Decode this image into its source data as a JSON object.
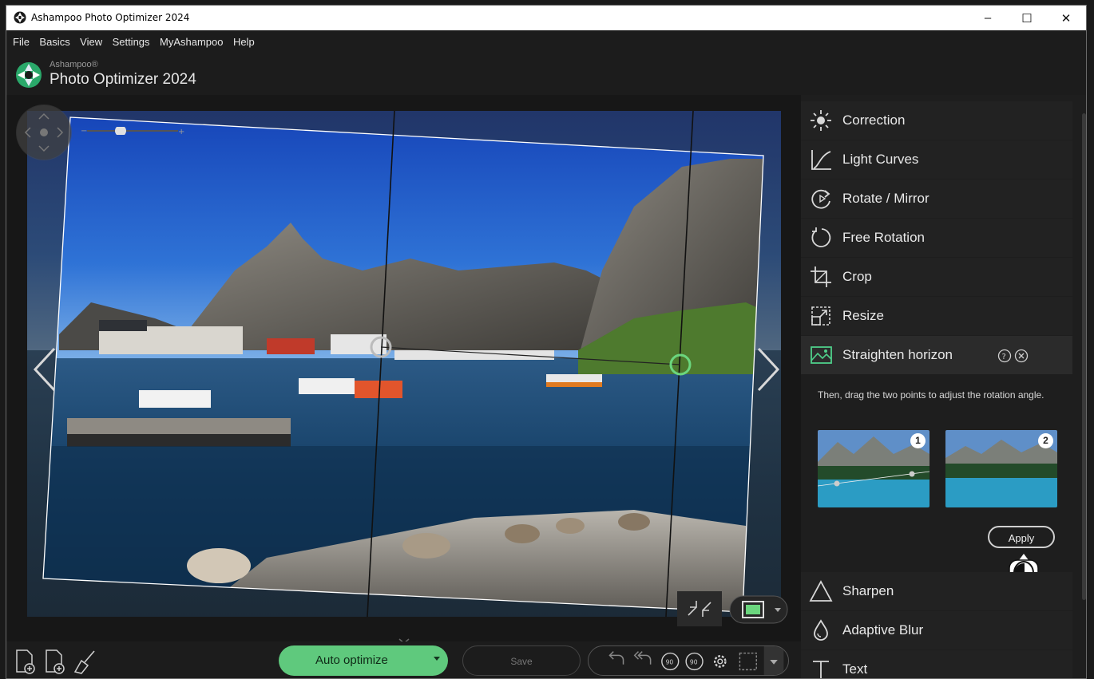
{
  "window": {
    "title": "Ashampoo Photo Optimizer 2024",
    "controls": {
      "minimize": "–",
      "maximize": "☐",
      "close": "✕"
    }
  },
  "menu": [
    "File",
    "Basics",
    "View",
    "Settings",
    "MyAshampoo",
    "Help"
  ],
  "brand": {
    "vendor": "Ashampoo®",
    "product": "Photo Optimizer 2024"
  },
  "tools": [
    {
      "label": "Correction",
      "icon": "sun-icon"
    },
    {
      "label": "Light Curves",
      "icon": "curve-icon"
    },
    {
      "label": "Rotate / Mirror",
      "icon": "rotate-icon"
    },
    {
      "label": "Free Rotation",
      "icon": "free-rotation-icon"
    },
    {
      "label": "Crop",
      "icon": "crop-icon"
    },
    {
      "label": "Resize",
      "icon": "resize-icon"
    },
    {
      "label": "Straighten horizon",
      "icon": "landscape-icon"
    },
    {
      "label": "Sharpen",
      "icon": "triangle-icon"
    },
    {
      "label": "Adaptive Blur",
      "icon": "drop-icon"
    },
    {
      "label": "Text",
      "icon": "text-icon"
    }
  ],
  "straighten": {
    "description": "Then, drag the two points to adjust the rotation angle.",
    "thumb1_number": "1",
    "thumb2_number": "2",
    "apply_label": "Apply"
  },
  "bottom": {
    "auto_optimize": "Auto optimize",
    "save": "Save"
  },
  "colors": {
    "accent": "#5fc97d",
    "background": "#1c1c1c",
    "panel": "#222222"
  }
}
